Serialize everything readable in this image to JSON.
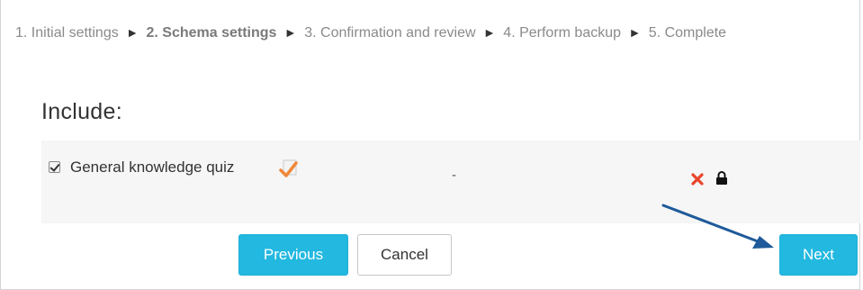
{
  "breadcrumb": {
    "step1": "1. Initial settings",
    "step2": "2. Schema settings",
    "step3": "3. Confirmation and review",
    "step4": "4. Perform backup",
    "step5": "5. Complete",
    "separator": "►"
  },
  "section": {
    "title": "Include:"
  },
  "item": {
    "checked": true,
    "label": "General knowledge quiz",
    "value": "-",
    "icons": {
      "edit": "edit-check-icon",
      "delete": "delete-x-icon",
      "lock": "lock-icon"
    }
  },
  "buttons": {
    "previous": "Previous",
    "cancel": "Cancel",
    "next": "Next"
  },
  "colors": {
    "primary": "#22b8e0",
    "delete": "#e8452c",
    "edit": "#f0883a",
    "annotation_arrow": "#1f5a9a",
    "row_background": "#f6f6f6"
  }
}
